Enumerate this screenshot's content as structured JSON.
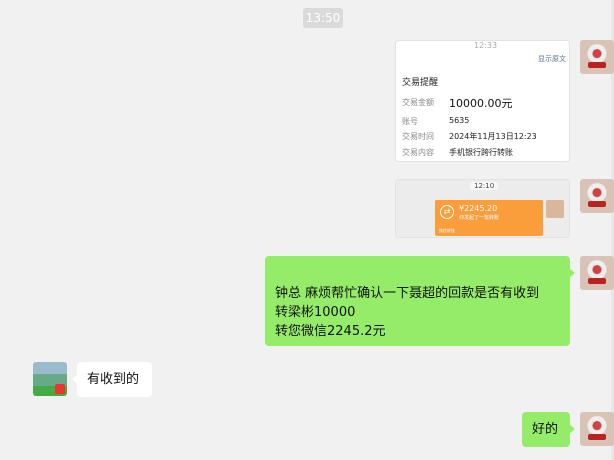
{
  "timestamp": "13:50",
  "messages": {
    "card1": {
      "header_time": "12:33",
      "view_original": "显示原文",
      "title": "交易提醒",
      "rows": [
        {
          "label": "交易金额",
          "value": "10000.00元"
        },
        {
          "label": "账号",
          "value": "5635"
        },
        {
          "label": "交易时间",
          "value": "2024年11月13日12:23"
        },
        {
          "label": "交易内容",
          "value": "手机银行跨行转账"
        }
      ]
    },
    "card2": {
      "header_time": "12:10",
      "transfer_amount": "¥2245.20",
      "transfer_sub": "你发起了一笔转账",
      "transfer_footer": "微信转账"
    },
    "green1": {
      "lines": [
        "钟总 麻烦帮忙确认一下聂超的回款是否有收到",
        "转梁彬10000",
        "转您微信2245.2元"
      ]
    },
    "left1": {
      "text": "有收到的"
    },
    "green2": {
      "text": "好的"
    }
  },
  "colors": {
    "bubble_green": "#95ec69",
    "transfer_orange": "#fa9d3b",
    "link_blue": "#576b95"
  }
}
